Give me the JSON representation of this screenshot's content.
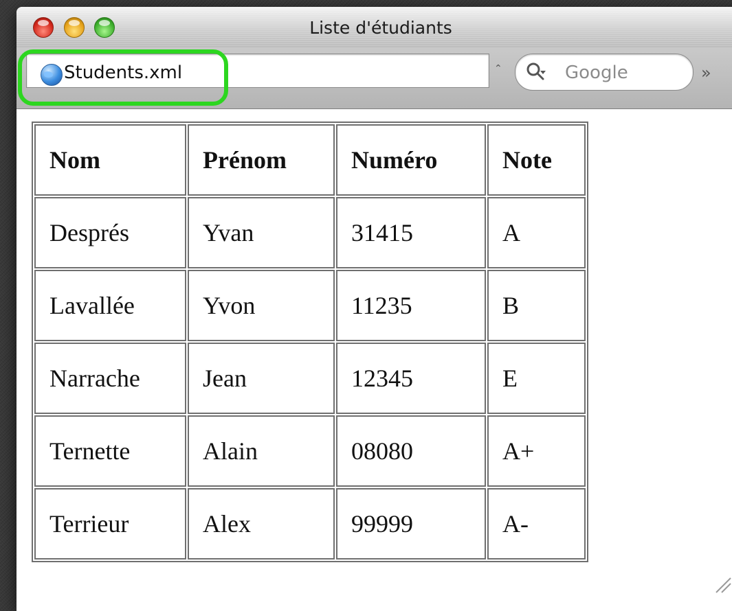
{
  "window": {
    "title": "Liste d'étudiants"
  },
  "toolbar": {
    "url": "Students.xml",
    "search_placeholder": "Google",
    "overflow_glyph": "»",
    "caret_glyph": "⌃"
  },
  "table": {
    "headers": [
      "Nom",
      "Prénom",
      "Numéro",
      "Note"
    ],
    "rows": [
      [
        "Després",
        "Yvan",
        "31415",
        "A"
      ],
      [
        "Lavallée",
        "Yvon",
        "11235",
        "B"
      ],
      [
        "Narrache",
        "Jean",
        "12345",
        "E"
      ],
      [
        "Ternette",
        "Alain",
        "08080",
        "A+"
      ],
      [
        "Terrieur",
        "Alex",
        "99999",
        "A-"
      ]
    ]
  },
  "icons": {
    "close": "close-icon",
    "minimize": "minimize-icon",
    "zoom": "zoom-icon",
    "site": "globe-icon",
    "search": "search-icon",
    "overflow": "chevrons-icon",
    "resize": "resize-grip-icon"
  },
  "colors": {
    "highlight": "#2dd620",
    "table_border": "#6f6f6f"
  }
}
